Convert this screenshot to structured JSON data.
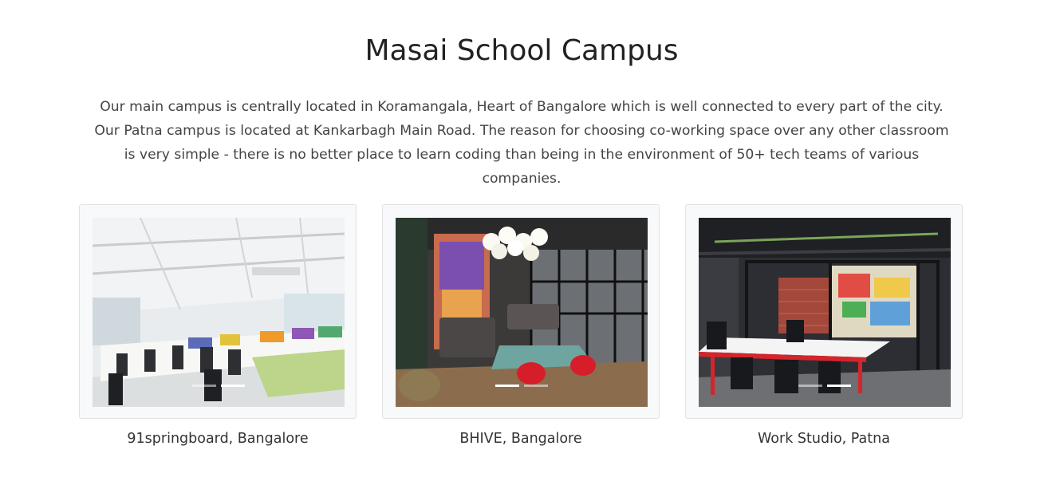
{
  "section": {
    "title": "Masai School Campus",
    "description": "Our main campus is centrally located in Koramangala, Heart of Bangalore which is well connected to every part of the city. Our Patna campus is located at Kankarbagh Main Road. The reason for choosing co-working space over any other classroom is very simple - there is no better place to learn coding than being in the environment of 50+ tech teams of various companies."
  },
  "campuses": [
    {
      "caption": "91springboard, Bangalore",
      "image": "open-plan-office-photo",
      "active_slide": 2,
      "slides": 2
    },
    {
      "caption": "BHIVE, Bangalore",
      "image": "lounge-coworking-photo",
      "active_slide": 1,
      "slides": 2
    },
    {
      "caption": "Work Studio, Patna",
      "image": "industrial-workspace-photo",
      "active_slide": 2,
      "slides": 2
    }
  ],
  "colors": {
    "card_background": "#f8f9fa",
    "card_border": "#dfe2e5",
    "text": "#333333",
    "indicator_active": "#ffffff"
  }
}
